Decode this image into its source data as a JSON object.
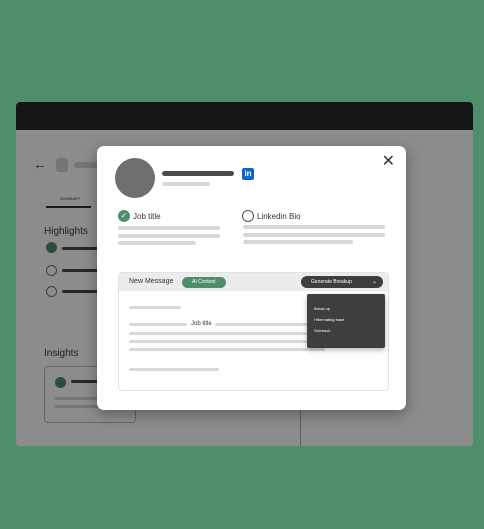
{
  "background_app": {
    "back_glyph": "←",
    "tab_label": "SUMMARY",
    "highlights_title": "Highlights",
    "insights_title": "Insights"
  },
  "modal": {
    "close_glyph": "✕",
    "linkedin_glyph": "in",
    "check_glyph": "✓",
    "options": [
      {
        "label": "Job title",
        "checked": true
      },
      {
        "label": "Linkedin Bio",
        "checked": false
      }
    ],
    "message": {
      "title": "New Message",
      "ai_button": "AI Content",
      "generate_label": "Generate Breakup",
      "generate_chevron": "⌄",
      "menu_items": [
        "Break up",
        "Hibernating base",
        "Outreach"
      ],
      "inline_title": "Job title"
    }
  },
  "colors": {
    "page_background": "#4f8e6b",
    "accent_green": "#4f8e6b",
    "linkedin_blue": "#0a66c2",
    "dark_menu": "#3e3e3e"
  }
}
